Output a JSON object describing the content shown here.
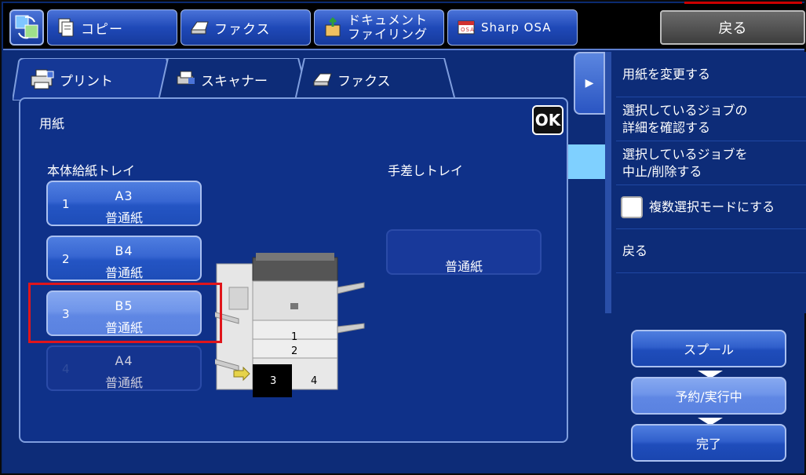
{
  "topbar": {
    "buttons": [
      {
        "label": "コピー",
        "icon": "copy-icon"
      },
      {
        "label": "ファクス",
        "icon": "fax-icon"
      },
      {
        "label": "ドキュメント\nファイリング",
        "line1": "ドキュメント",
        "line2": "ファイリング",
        "icon": "document-filing-icon"
      },
      {
        "label": "Sharp OSA",
        "icon": "sharp-osa-icon"
      }
    ],
    "back_label": "戻る"
  },
  "tabs": [
    {
      "label": "プリント",
      "icon": "print-icon",
      "active": true
    },
    {
      "label": "スキャナー",
      "icon": "scanner-icon",
      "active": false
    },
    {
      "label": "ファクス",
      "icon": "fax-icon",
      "active": false
    }
  ],
  "panel": {
    "title": "用紙",
    "ok_label": "OK",
    "main_trays_label": "本体給紙トレイ",
    "bypass_label": "手差しトレイ",
    "trays": [
      {
        "num": "1",
        "size": "A3",
        "type": "普通紙",
        "state": "normal"
      },
      {
        "num": "2",
        "size": "B4",
        "type": "普通紙",
        "state": "normal"
      },
      {
        "num": "3",
        "size": "B5",
        "type": "普通紙",
        "state": "selected"
      },
      {
        "num": "4",
        "size": "A4",
        "type": "普通紙",
        "state": "dimmed"
      }
    ],
    "bypass": {
      "type": "普通紙"
    },
    "machine_labels": {
      "t1": "1",
      "t2": "2",
      "t3": "3",
      "t4": "4"
    }
  },
  "side_menu": {
    "items": [
      {
        "line1": "用紙を変更する",
        "line2": ""
      },
      {
        "line1": "選択しているジョブの",
        "line2": "詳細を確認する"
      },
      {
        "line1": "選択しているジョブを",
        "line2": "中止/削除する"
      },
      {
        "line1": "複数選択モードにする",
        "line2": ""
      },
      {
        "line1": "戻る",
        "line2": ""
      }
    ]
  },
  "actions": {
    "spool": "スプール",
    "queue": "予約/実行中",
    "complete": "完了"
  },
  "colors": {
    "background": "#0d2c78",
    "button_blue": "#3766d2",
    "selected": "#6f95ea",
    "highlight_red": "#e0151b",
    "accent_cyan": "#7fd0ff"
  }
}
